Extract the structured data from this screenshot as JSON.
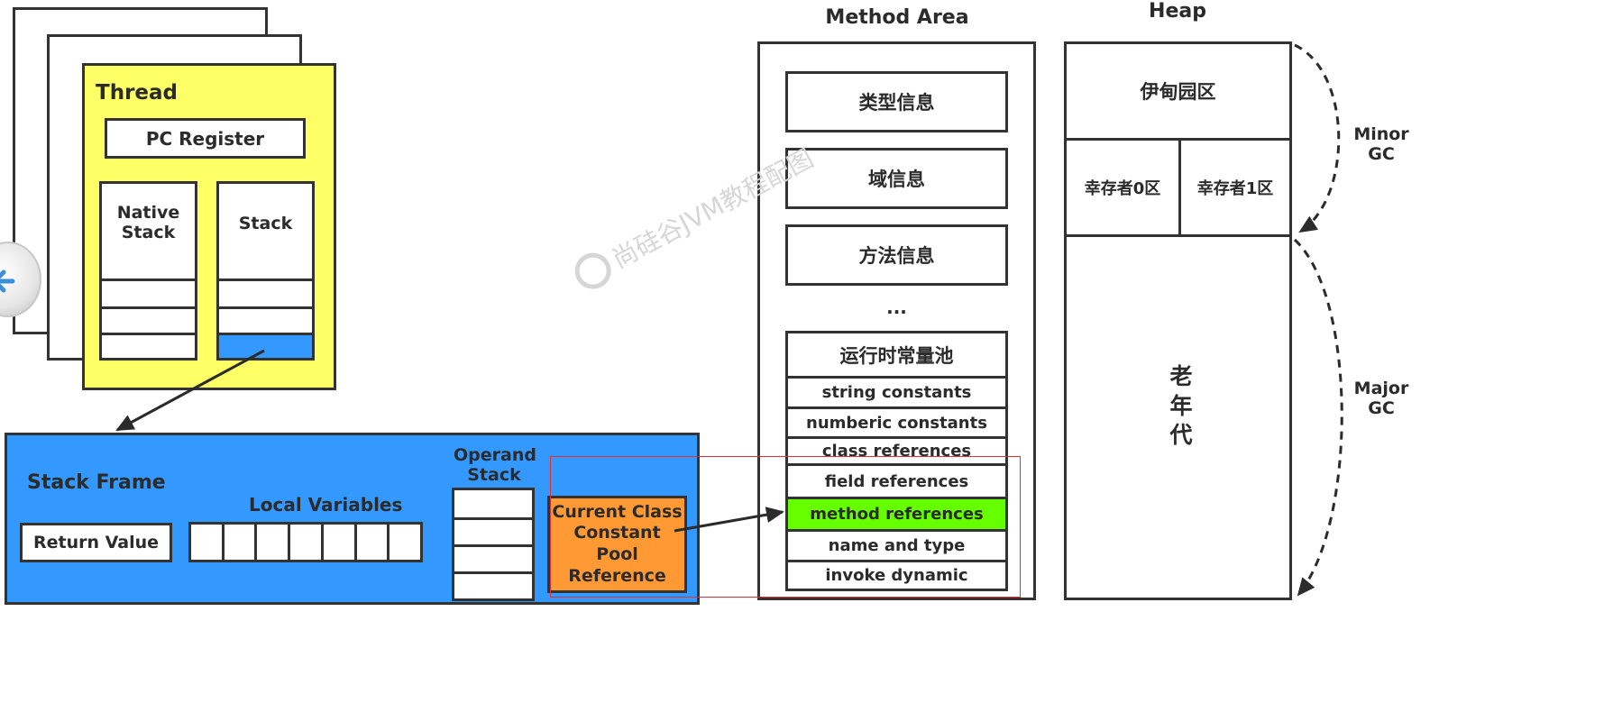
{
  "thread": {
    "title": "Thread",
    "pc_register": "PC Register",
    "native_stack": "Native\nStack",
    "stack": "Stack"
  },
  "stack_frame": {
    "title": "Stack Frame",
    "local_variables": "Local Variables",
    "operand_stack": "Operand\nStack",
    "return_value": "Return Value",
    "current_class": "Current Class\nConstant Pool\nReference"
  },
  "method_area": {
    "title": "Method Area",
    "items": [
      "类型信息",
      "域信息",
      "方法信息"
    ],
    "ellipsis": "...",
    "runtime_pool": {
      "title": "运行时常量池",
      "entries": [
        "string constants",
        "numberic constants",
        "class references",
        "field references",
        "method references",
        "name and type",
        "invoke dynamic"
      ]
    }
  },
  "heap": {
    "title": "Heap",
    "eden": "伊甸园区",
    "survivor0": "幸存者0区",
    "survivor1": "幸存者1区",
    "old_gen": "老\n年\n代",
    "minor_gc": "Minor\nGC",
    "major_gc": "Major\nGC"
  },
  "watermark": "尚硅谷JVM教程配图",
  "colors": {
    "thread_bg": "#ffff66",
    "stack_frame_bg": "#3399ff",
    "stack_top": "#3399ff",
    "current_class_bg": "#ff9933",
    "method_ref_bg": "#66ff00",
    "highlight_border": "#e03030"
  },
  "icons": {
    "back": "back-arrow-icon"
  }
}
